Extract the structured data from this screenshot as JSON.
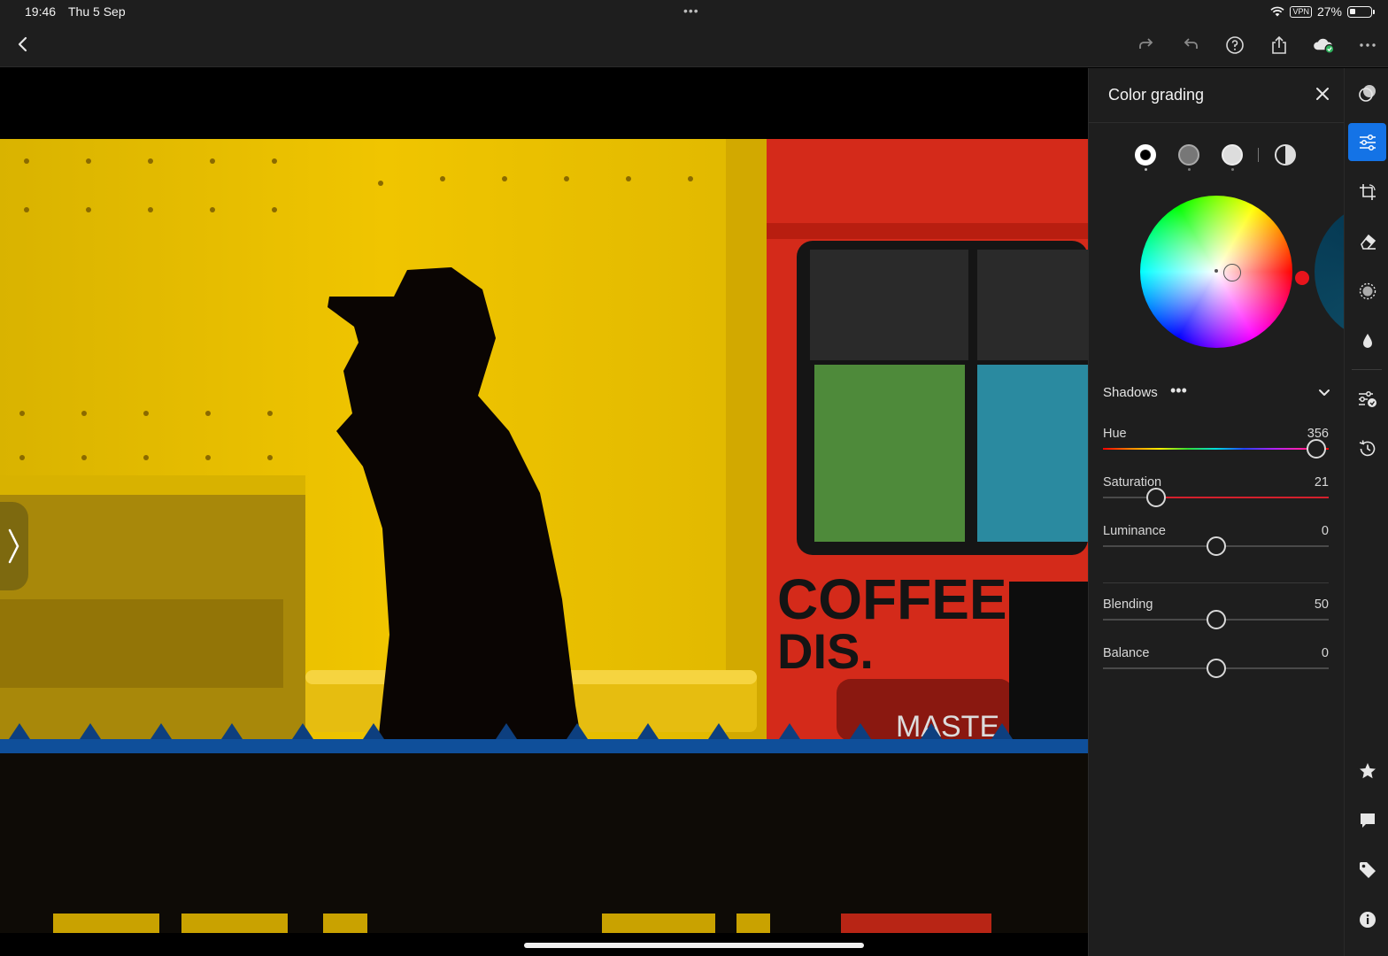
{
  "status_bar": {
    "time": "19:46",
    "date": "Thu 5 Sep",
    "vpn": "VPN",
    "battery": "27%"
  },
  "toolbar": {
    "back_icon": "chevron-left-icon",
    "icons": [
      "redo-icon",
      "undo-icon",
      "help-icon",
      "share-icon",
      "cloud-synced-icon",
      "more-icon"
    ]
  },
  "photo": {
    "sign_text_1": "COFFEE",
    "sign_text_2": "DIS.",
    "sign_text_3": "MASTE"
  },
  "panel": {
    "title": "Color grading",
    "modes": [
      "shadows-mode",
      "midtones-mode",
      "highlights-mode",
      "global-mode"
    ],
    "selected_mode": "shadows-mode",
    "section": "Shadows",
    "section_more": "•••",
    "sliders": [
      {
        "label": "Hue",
        "value": "356",
        "fraction": 0.99,
        "track": "hue"
      },
      {
        "label": "Saturation",
        "value": "21",
        "fraction": 0.21,
        "track": "saturation"
      },
      {
        "label": "Luminance",
        "value": "0",
        "fraction": 0.5,
        "track": "plain"
      },
      {
        "label": "Blending",
        "value": "50",
        "fraction": 0.5,
        "track": "plain"
      },
      {
        "label": "Balance",
        "value": "0",
        "fraction": 0.5,
        "track": "plain"
      }
    ],
    "colors": {
      "accent": "#1473e6",
      "wheel_marker": "#e8141c",
      "panel_bg": "#1e1e1e"
    }
  },
  "rail": {
    "icons": [
      "presets-icon",
      "adjust-icon",
      "crop-icon",
      "heal-icon",
      "masking-icon",
      "blur-icon",
      "versions-icon",
      "history-icon",
      "star-icon",
      "comment-icon",
      "tag-icon",
      "info-icon"
    ],
    "active": "adjust-icon"
  }
}
